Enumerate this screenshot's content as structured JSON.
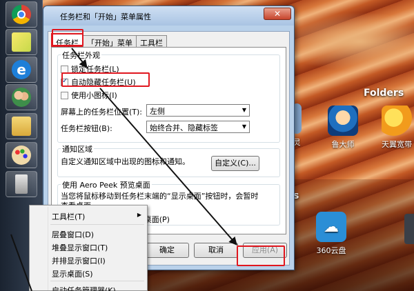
{
  "dialog": {
    "title": "任务栏和「开始」菜单属性",
    "close": "✕",
    "tabs": [
      "任务栏",
      "「开始」菜单",
      "工具栏"
    ],
    "appearance_group": "任务栏外观",
    "lock_taskbar": "锁定任务栏(L)",
    "auto_hide": "自动隐藏任务栏(U)",
    "small_icons": "使用小图标(I)",
    "position_label": "屏幕上的任务栏位置(T):",
    "position_value": "左侧",
    "buttons_label": "任务栏按钮(B):",
    "buttons_value": "始终合并、隐藏标签",
    "notify_group": "通知区域",
    "notify_text": "自定义通知区域中出现的图标和通知。",
    "customize_button": "自定义(C)...",
    "aero_group": "使用 Aero Peek 预览桌面",
    "aero_text": "当您将鼠标移动到任务栏末端的“显示桌面”按钮时，会暂时查看桌面。",
    "aero_check": "使用 Aero Peek 预览桌面(P)",
    "ok_button": "确定",
    "cancel_button": "取消",
    "apply_button": "应用(A)"
  },
  "context_menu": {
    "items": [
      "工具栏(T)",
      "层叠窗口(D)",
      "堆叠显示窗口(T)",
      "并排显示窗口(I)",
      "显示桌面(S)",
      "启动任务管理器(K)"
    ],
    "arrow": "▶"
  },
  "desktop": {
    "section_label": "Folders",
    "icons": [
      "灵",
      "鲁大师",
      "天翼宽带",
      "360云盘"
    ],
    "partial_text": "s"
  },
  "colors": {
    "highlight": "#e0161e",
    "arrow": "#111111"
  }
}
